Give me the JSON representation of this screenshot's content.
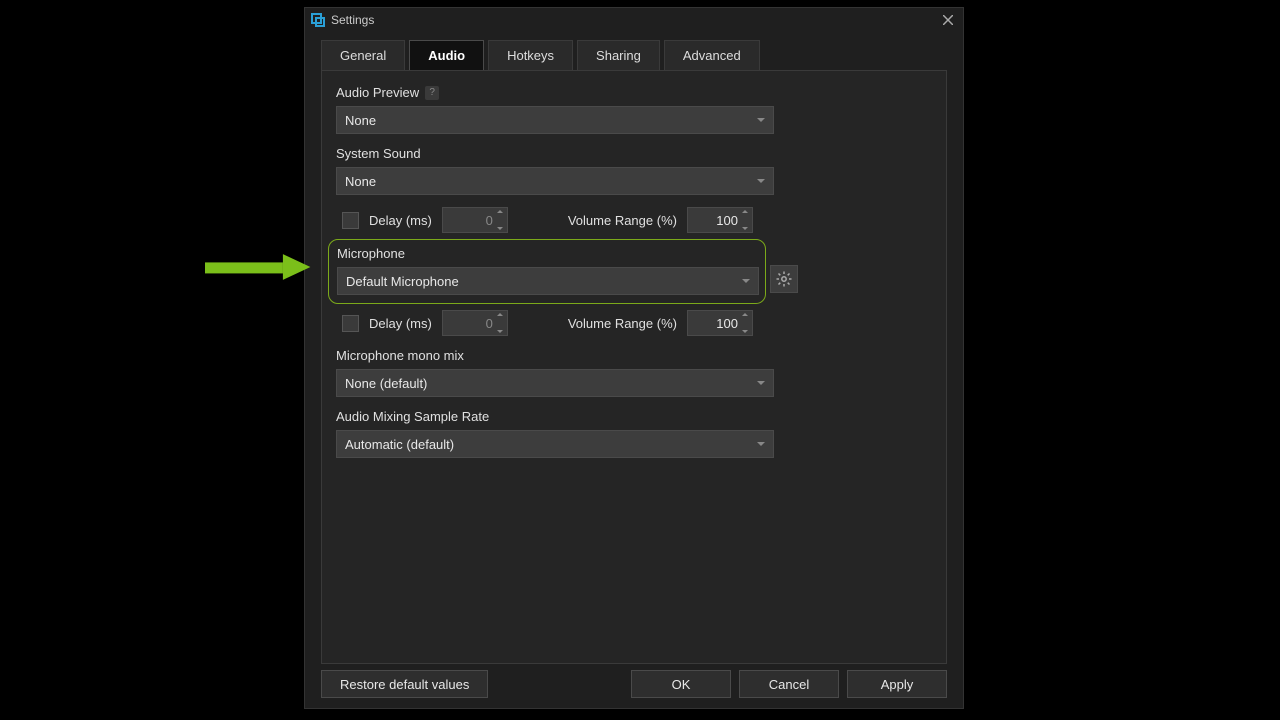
{
  "window": {
    "title": "Settings"
  },
  "tabs": {
    "general": "General",
    "audio": "Audio",
    "hotkeys": "Hotkeys",
    "sharing": "Sharing",
    "advanced": "Advanced",
    "active": "Audio"
  },
  "colors": {
    "highlight": "#7caa1a"
  },
  "audio": {
    "preview": {
      "label": "Audio Preview",
      "value": "None"
    },
    "system_sound": {
      "label": "System Sound",
      "value": "None",
      "delay_label": "Delay (ms)",
      "delay_value": "0",
      "volume_label": "Volume Range (%)",
      "volume_value": "100"
    },
    "microphone": {
      "label": "Microphone",
      "value": "Default Microphone",
      "delay_label": "Delay (ms)",
      "delay_value": "0",
      "volume_label": "Volume Range (%)",
      "volume_value": "100"
    },
    "mono_mix": {
      "label": "Microphone mono mix",
      "value": "None (default)"
    },
    "sample_rate": {
      "label": "Audio Mixing Sample Rate",
      "value": "Automatic (default)"
    }
  },
  "footer": {
    "restore": "Restore default values",
    "ok": "OK",
    "cancel": "Cancel",
    "apply": "Apply"
  }
}
